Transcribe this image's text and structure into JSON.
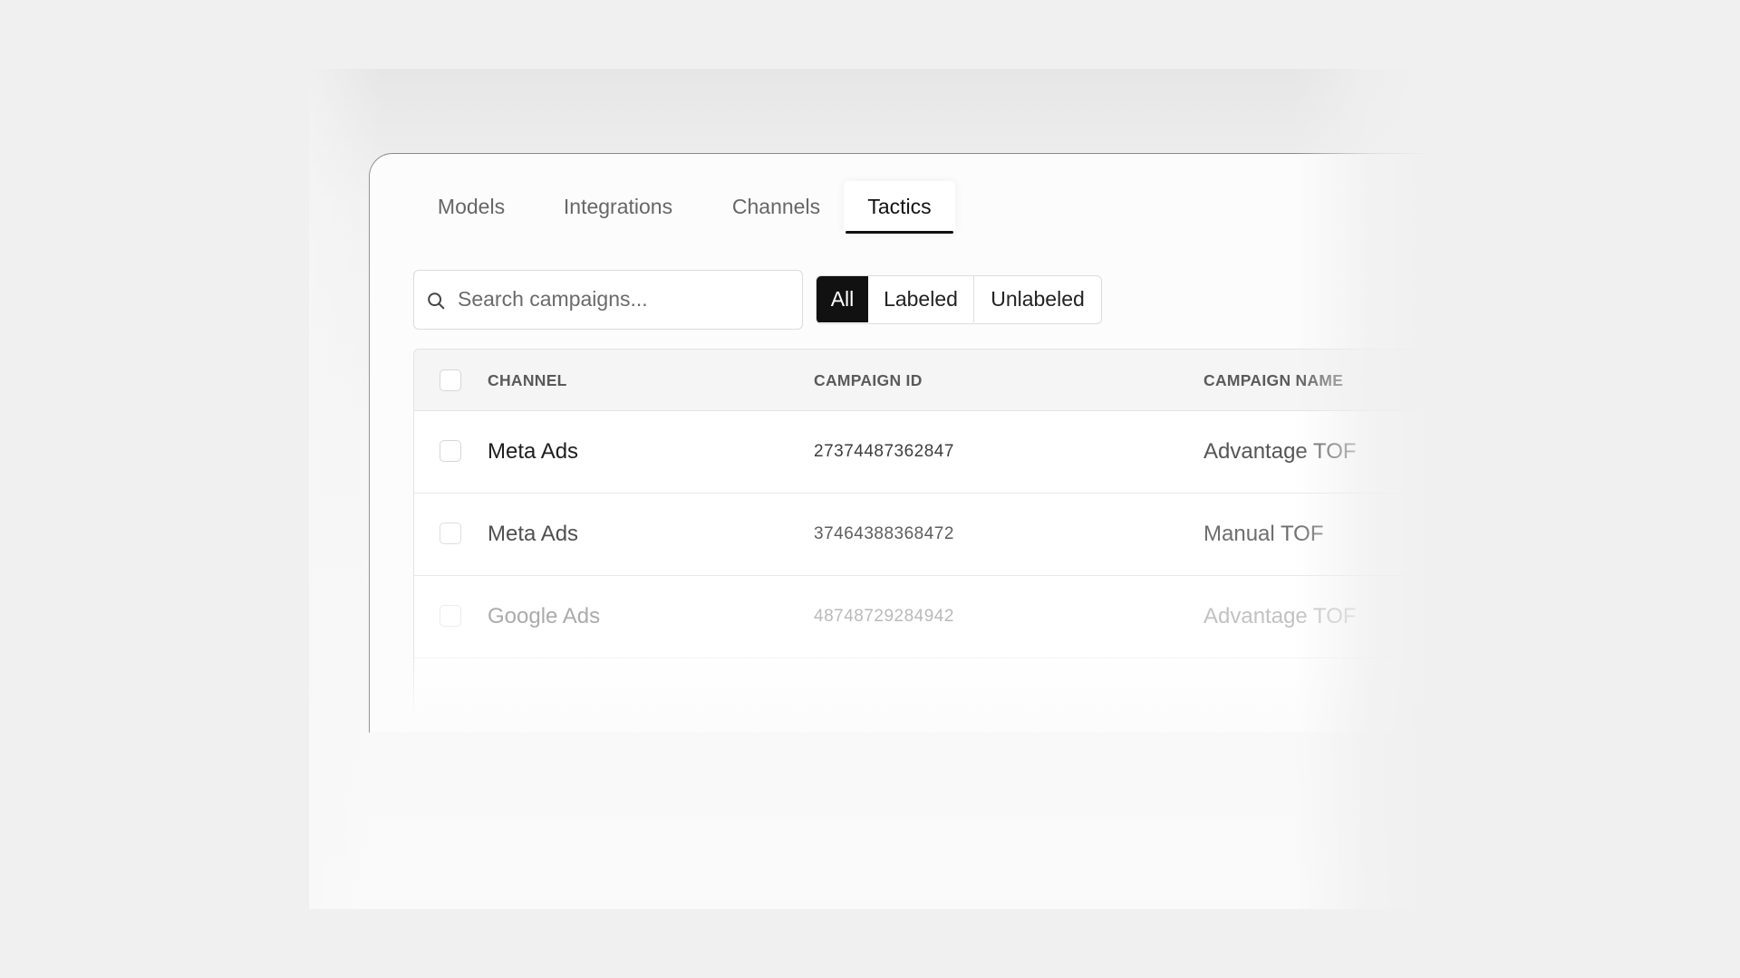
{
  "tabs": [
    {
      "label": "Models"
    },
    {
      "label": "Integrations"
    },
    {
      "label": "Channels"
    },
    {
      "label": "Tactics",
      "active": true
    }
  ],
  "search": {
    "placeholder": "Search campaigns...",
    "value": ""
  },
  "filter": {
    "options": [
      "All",
      "Labeled",
      "Unlabeled"
    ],
    "selected": "All"
  },
  "table": {
    "columns": [
      "CHANNEL",
      "CAMPAIGN ID",
      "CAMPAIGN NAME"
    ],
    "rows": [
      {
        "channel": "Meta Ads",
        "campaign_id": "27374487362847",
        "campaign_name": "Advantage TOF"
      },
      {
        "channel": "Meta Ads",
        "campaign_id": "37464388368472",
        "campaign_name": "Manual TOF"
      },
      {
        "channel": "Google Ads",
        "campaign_id": "48748729284942",
        "campaign_name": "Advantage TOF"
      }
    ]
  },
  "colors": {
    "background": "#f0f0f0",
    "active_accent": "#111111",
    "border": "#dcdcdc"
  }
}
